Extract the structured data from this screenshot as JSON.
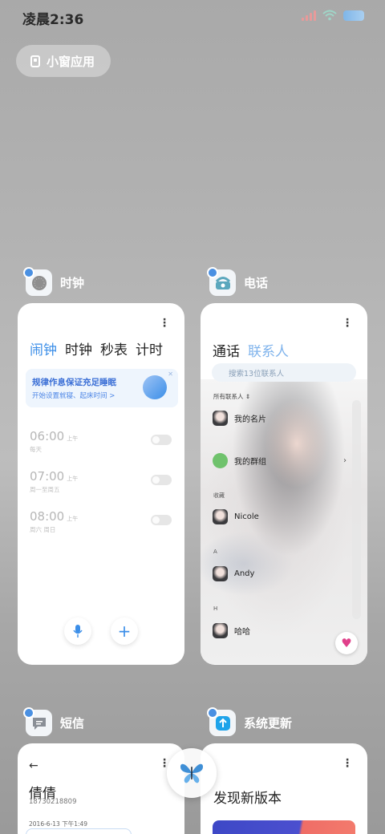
{
  "status_bar": {
    "time": "凌晨2:36"
  },
  "float_pill": {
    "label": "小窗应用"
  },
  "clock_app": {
    "name": "时钟",
    "tabs": [
      "闹钟",
      "时钟",
      "秒表",
      "计时"
    ],
    "active_tab": "闹钟",
    "sleep_banner": {
      "title": "规律作息保证充足睡眠",
      "subtitle": "开始设置就寝、起床时间 >"
    },
    "alarms": [
      {
        "time": "06:00",
        "period": "上午",
        "days": "每天"
      },
      {
        "time": "07:00",
        "period": "上午",
        "days": "周一至周五"
      },
      {
        "time": "08:00",
        "period": "上午",
        "days": "周六 周日"
      }
    ]
  },
  "phone_app": {
    "name": "电话",
    "tabs": [
      "通话",
      "联系人"
    ],
    "active_tab": "联系人",
    "search_placeholder": "搜索13位联系人",
    "section_all": "所有联系人",
    "contacts": [
      {
        "name": "我的名片"
      },
      {
        "name": "我的群组"
      },
      {
        "name": "Nicole",
        "section": "收藏"
      },
      {
        "name": "Andy",
        "section": "A"
      },
      {
        "name": "哈哈",
        "section": "H"
      }
    ]
  },
  "sms_app": {
    "name": "短信",
    "contact_name": "倩倩",
    "contact_number": "18730218809",
    "date": "2016-6-13 下午1:49"
  },
  "update_app": {
    "name": "系统更新",
    "title": "发现新版本"
  },
  "colors": {
    "accent": "#3b8ee8",
    "accent_light": "#7fb3ec"
  }
}
